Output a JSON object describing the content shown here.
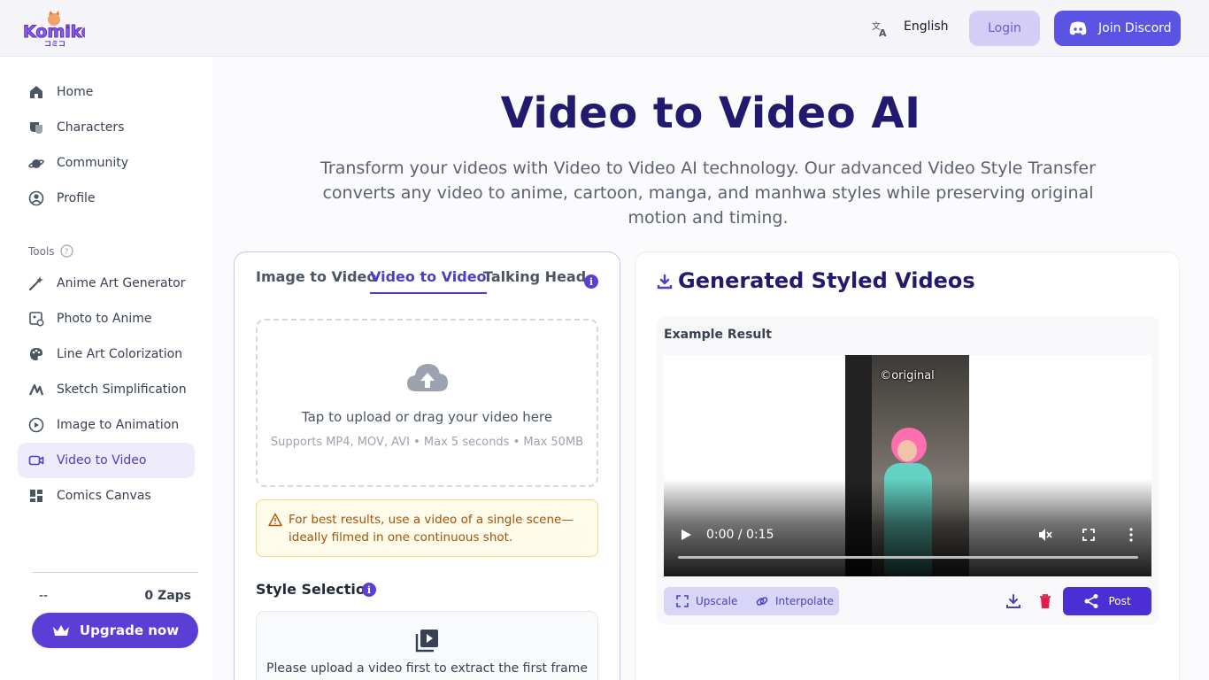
{
  "header": {
    "logo_text": "Komiko",
    "logo_subtext": "コミコ",
    "language": "English",
    "login": "Login",
    "discord": "Join Discord"
  },
  "sidebar": {
    "items": [
      {
        "label": "Home",
        "icon": "home-icon"
      },
      {
        "label": "Characters",
        "icon": "characters-icon"
      },
      {
        "label": "Community",
        "icon": "community-icon"
      },
      {
        "label": "Profile",
        "icon": "profile-icon"
      }
    ],
    "tools_label": "Tools",
    "tools": [
      {
        "label": "Anime Art Generator",
        "icon": "magic-wand-icon"
      },
      {
        "label": "Photo to Anime",
        "icon": "photo-icon"
      },
      {
        "label": "Line Art Colorization",
        "icon": "palette-icon"
      },
      {
        "label": "Sketch Simplification",
        "icon": "sketch-icon"
      },
      {
        "label": "Image to Animation",
        "icon": "play-circle-icon"
      },
      {
        "label": "Video to Video",
        "icon": "video-camera-icon"
      },
      {
        "label": "Comics Canvas",
        "icon": "grid-icon"
      }
    ],
    "active_tool": "Video to Video",
    "balance": "--",
    "zaps": "0 Zaps",
    "upgrade": "Upgrade now"
  },
  "main": {
    "title": "Video to Video AI",
    "description": "Transform your videos with Video to Video AI technology. Our advanced Video Style Transfer converts any video to anime, cartoon, manga, and manhwa styles while preserving original motion and timing."
  },
  "left_panel": {
    "tabs": [
      "Image to Video",
      "Video to Video",
      "Talking Head"
    ],
    "active_tab": "Video to Video",
    "info": "i",
    "upload_text": "Tap to upload or drag your video here",
    "upload_sub": "Supports MP4, MOV, AVI • Max 5 seconds • Max 50MB",
    "warning": "For best results, use a video of a single scene—ideally filmed in one continuous shot.",
    "style_selection": "Style Selection",
    "style_placeholder": "Please upload a video first to extract the first frame"
  },
  "right_panel": {
    "title": "Generated Styled Videos",
    "example_label": "Example Result",
    "video_watermark": "©original",
    "time": "0:00 / 0:15",
    "upscale": "Upscale",
    "interpolate": "Interpolate",
    "post": "Post"
  },
  "colors": {
    "brand": "#5b3ed6",
    "title": "#211a6e",
    "active_bg": "#eeecfa"
  }
}
